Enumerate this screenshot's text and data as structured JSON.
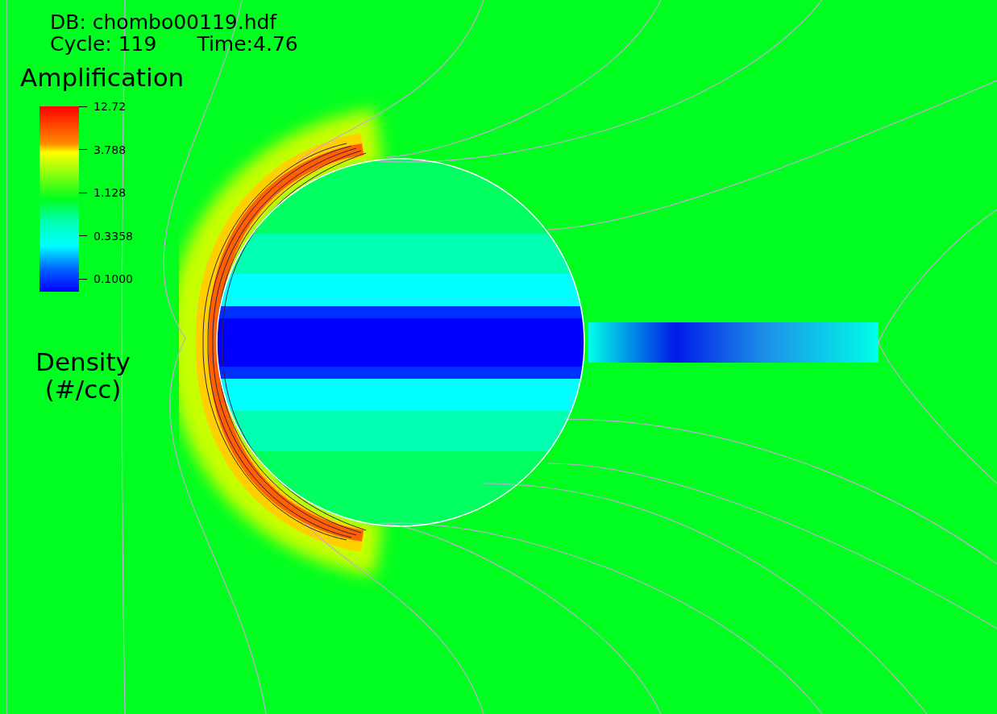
{
  "plot": {
    "database": "DB: chombo00119.hdf",
    "cycle": "Cycle: 119",
    "time": "Time:4.76"
  },
  "legend": {
    "title": "Amplification",
    "ticks": [
      "12.72",
      "3.788",
      "1.128",
      "0.3358",
      "0.1000"
    ],
    "variable": "Density (#/cc)"
  }
}
